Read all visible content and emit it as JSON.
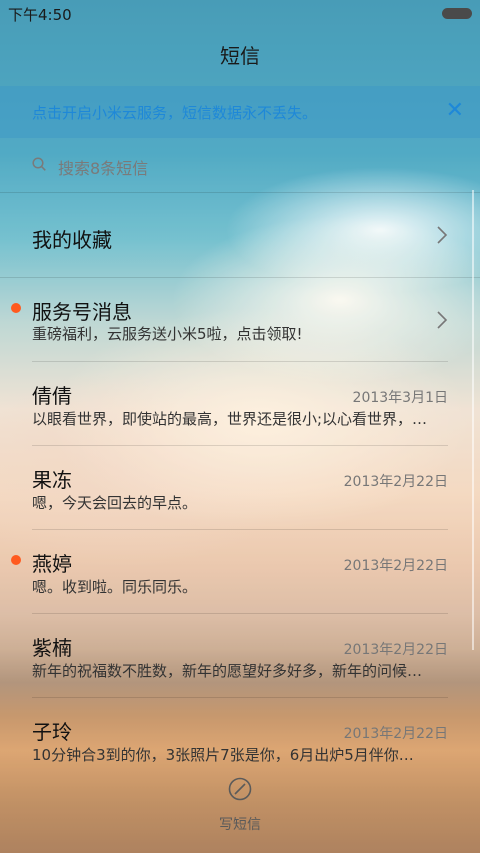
{
  "status": {
    "time": "下午4:50"
  },
  "header": {
    "title": "短信"
  },
  "banner": {
    "text": "点击开启小米云服务，短信数据永不丢失。",
    "close": "✕"
  },
  "search": {
    "placeholder": "搜索8条短信"
  },
  "favorites": {
    "label": "我的收藏"
  },
  "service": {
    "title": "服务号消息",
    "subtitle": "重磅福利，云服务送小米5啦，点击领取!"
  },
  "messages": [
    {
      "name": "倩倩",
      "date": "2013年3月1日",
      "preview": "以眼看世界，即使站的最高，世界还是很小;以心看世界，…"
    },
    {
      "name": "果冻",
      "date": "2013年2月22日",
      "preview": "嗯，今天会回去的早点。"
    },
    {
      "name": "燕婷",
      "date": "2013年2月22日",
      "preview": "嗯。收到啦。同乐同乐。",
      "unread": true
    },
    {
      "name": "紫楠",
      "date": "2013年2月22日",
      "preview": "新年的祝福数不胜数，新年的愿望好多好多，新年的问候…"
    },
    {
      "name": "子玲",
      "date": "2013年2月22日",
      "preview": "10分钟合3到的你，3张照片7张是你，6月出炉5月伴你…"
    }
  ],
  "compose": {
    "label": "写短信"
  },
  "colors": {
    "accent": "#1e88d8",
    "unread_dot": "#ff5a1f"
  }
}
